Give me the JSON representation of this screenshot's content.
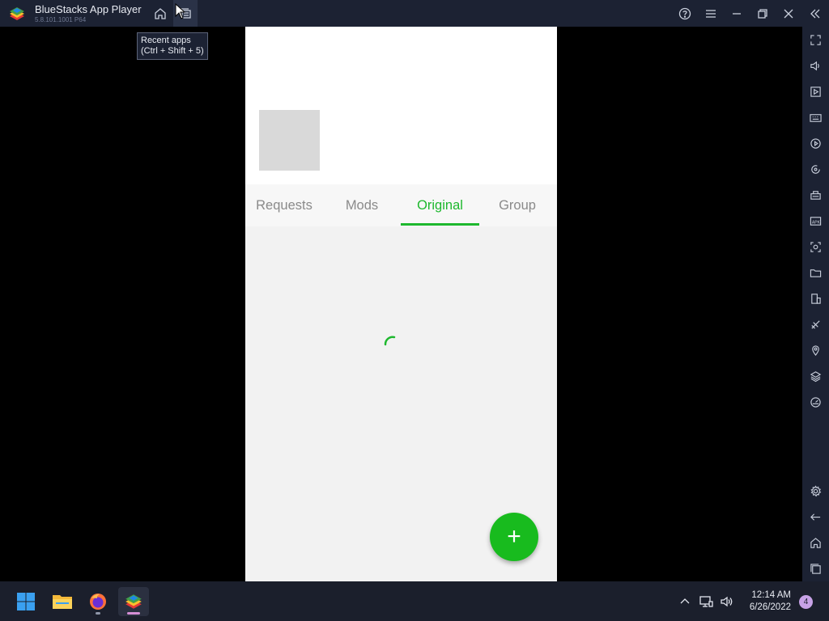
{
  "window": {
    "title": "BlueStacks App Player",
    "version": "5.8.101.1001 P64",
    "tooltip": "Recent apps\n(Ctrl + Shift + 5)"
  },
  "titlebar_icons": [
    "home-icon",
    "recent-apps-icon",
    "help-icon",
    "menu-icon",
    "minimize-icon",
    "restore-icon",
    "close-icon",
    "collapse-sidebar-icon"
  ],
  "sidebar_icons": [
    "fullscreen-icon",
    "volume-icon",
    "media-manager-icon",
    "keyboard-controls-icon",
    "macro-recorder-icon",
    "sync-icon",
    "game-controls-icon",
    "install-apk-icon",
    "screenshot-icon",
    "folder-icon",
    "multi-instance-icon",
    "eco-mode-icon",
    "location-icon",
    "layers-icon",
    "performance-icon",
    "settings-icon",
    "back-icon",
    "android-home-icon",
    "android-recents-icon"
  ],
  "app": {
    "tabs": [
      {
        "label": "Requests",
        "active": false
      },
      {
        "label": "Mods",
        "active": false
      },
      {
        "label": "Original",
        "active": true
      },
      {
        "label": "Group",
        "active": false
      }
    ],
    "fab_label": "+",
    "accent_color": "#1eb82e"
  },
  "taskbar": {
    "apps": [
      "windows-start-icon",
      "file-explorer-icon",
      "firefox-icon",
      "bluestacks-icon"
    ],
    "time": "12:14 AM",
    "date": "6/26/2022",
    "notification_count": "4"
  }
}
